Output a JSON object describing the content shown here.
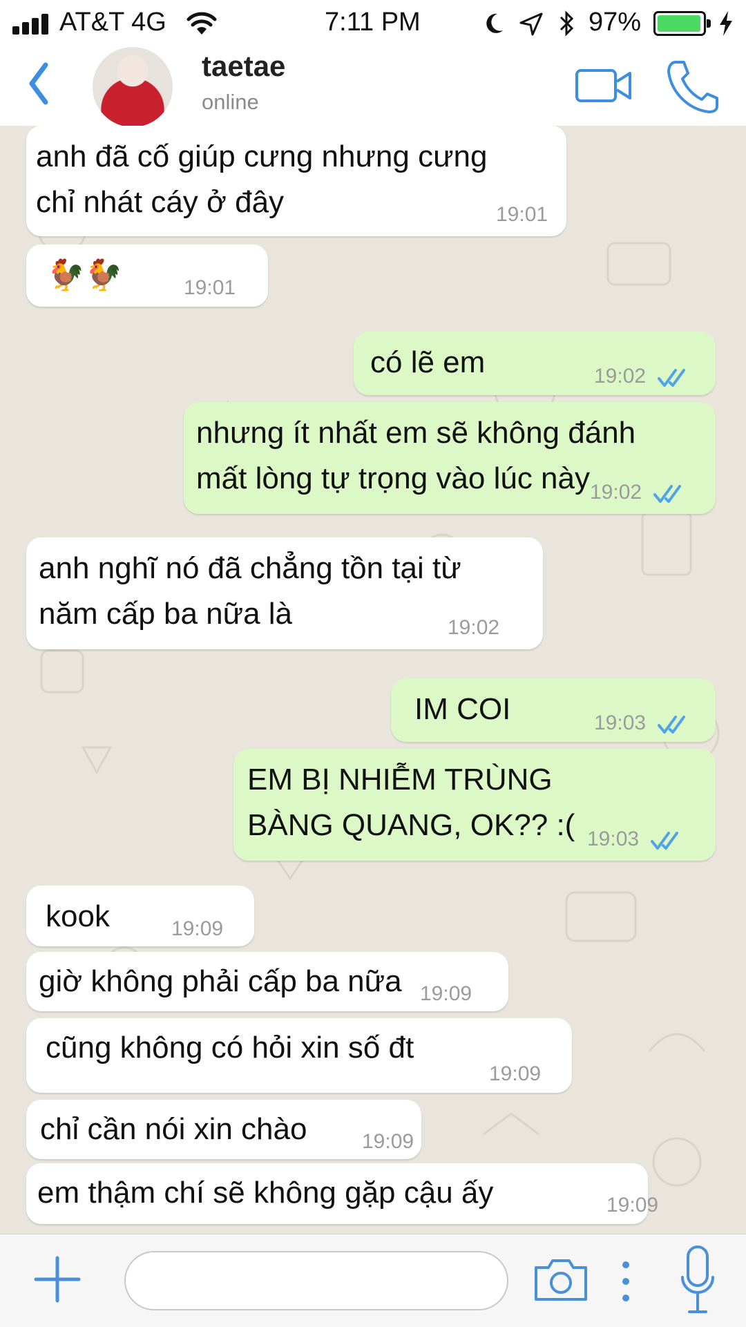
{
  "status_bar": {
    "carrier": "AT&T 4G",
    "time": "7:11 PM",
    "battery_percent": "97%",
    "battery_level": 0.97
  },
  "header": {
    "contact_name": "taetae",
    "presence": "online"
  },
  "messages": [
    {
      "direction": "in",
      "text": "anh đã cố giúp cưng nhưng cưng\nchỉ nhát cáy ở đây",
      "time": "19:01"
    },
    {
      "direction": "in",
      "text": "🐓🐓",
      "time": "19:01"
    },
    {
      "direction": "out",
      "text": "có lẽ em",
      "time": "19:02",
      "status": "read"
    },
    {
      "direction": "out",
      "text": "nhưng ít nhất em sẽ không đánh\nmất lòng tự trọng vào lúc này",
      "time": "19:02",
      "status": "read"
    },
    {
      "direction": "in",
      "text": "anh nghĩ nó đã chẳng tồn tại từ\nnăm cấp ba nữa là",
      "time": "19:02"
    },
    {
      "direction": "out",
      "text": "IM COI",
      "time": "19:03",
      "status": "read"
    },
    {
      "direction": "out",
      "text": "EM BỊ NHIỄM TRÙNG\nBÀNG QUANG, OK?? :(",
      "time": "19:03",
      "status": "read"
    },
    {
      "direction": "in",
      "text": "kook",
      "time": "19:09"
    },
    {
      "direction": "in",
      "text": "giờ không phải cấp ba nữa",
      "time": "19:09"
    },
    {
      "direction": "in",
      "text": "cũng không có hỏi xin số đt",
      "time": "19:09"
    },
    {
      "direction": "in",
      "text": "chỉ cần nói xin chào",
      "time": "19:09"
    },
    {
      "direction": "in",
      "text": "em thậm chí sẽ không gặp cậu ấy",
      "time": "19:09"
    }
  ],
  "input": {
    "placeholder": ""
  },
  "icons": {
    "back": "chevron-left-icon",
    "video": "video-camera-icon",
    "call": "phone-icon",
    "add": "plus-icon",
    "camera": "camera-icon",
    "more": "more-dots-icon",
    "mic": "microphone-icon"
  },
  "colors": {
    "accent": "#3d8ee0",
    "outgoing_bubble": "#dcf8c6",
    "incoming_bubble": "#ffffff",
    "chat_bg": "#e9e5dc",
    "read_ticks": "#4fa3e6"
  }
}
